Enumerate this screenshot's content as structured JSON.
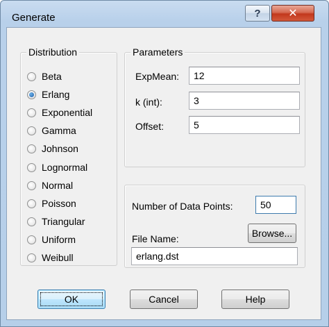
{
  "window": {
    "title": "Generate",
    "help_glyph": "?",
    "close_glyph": "✕"
  },
  "distribution": {
    "label": "Distribution",
    "selected": "Erlang",
    "options": [
      "Beta",
      "Erlang",
      "Exponential",
      "Gamma",
      "Johnson",
      "Lognormal",
      "Normal",
      "Poisson",
      "Triangular",
      "Uniform",
      "Weibull"
    ]
  },
  "parameters": {
    "label": "Parameters",
    "fields": [
      {
        "label": "ExpMean:",
        "value": "12"
      },
      {
        "label": "k (int):",
        "value": "3"
      },
      {
        "label": "Offset:",
        "value": "5"
      }
    ]
  },
  "output": {
    "num_points_label": "Number of Data Points:",
    "num_points_value": "50",
    "file_name_label": "File Name:",
    "file_name_value": "erlang.dst",
    "browse_label": "Browse..."
  },
  "buttons": {
    "ok": "OK",
    "cancel": "Cancel",
    "help": "Help"
  }
}
